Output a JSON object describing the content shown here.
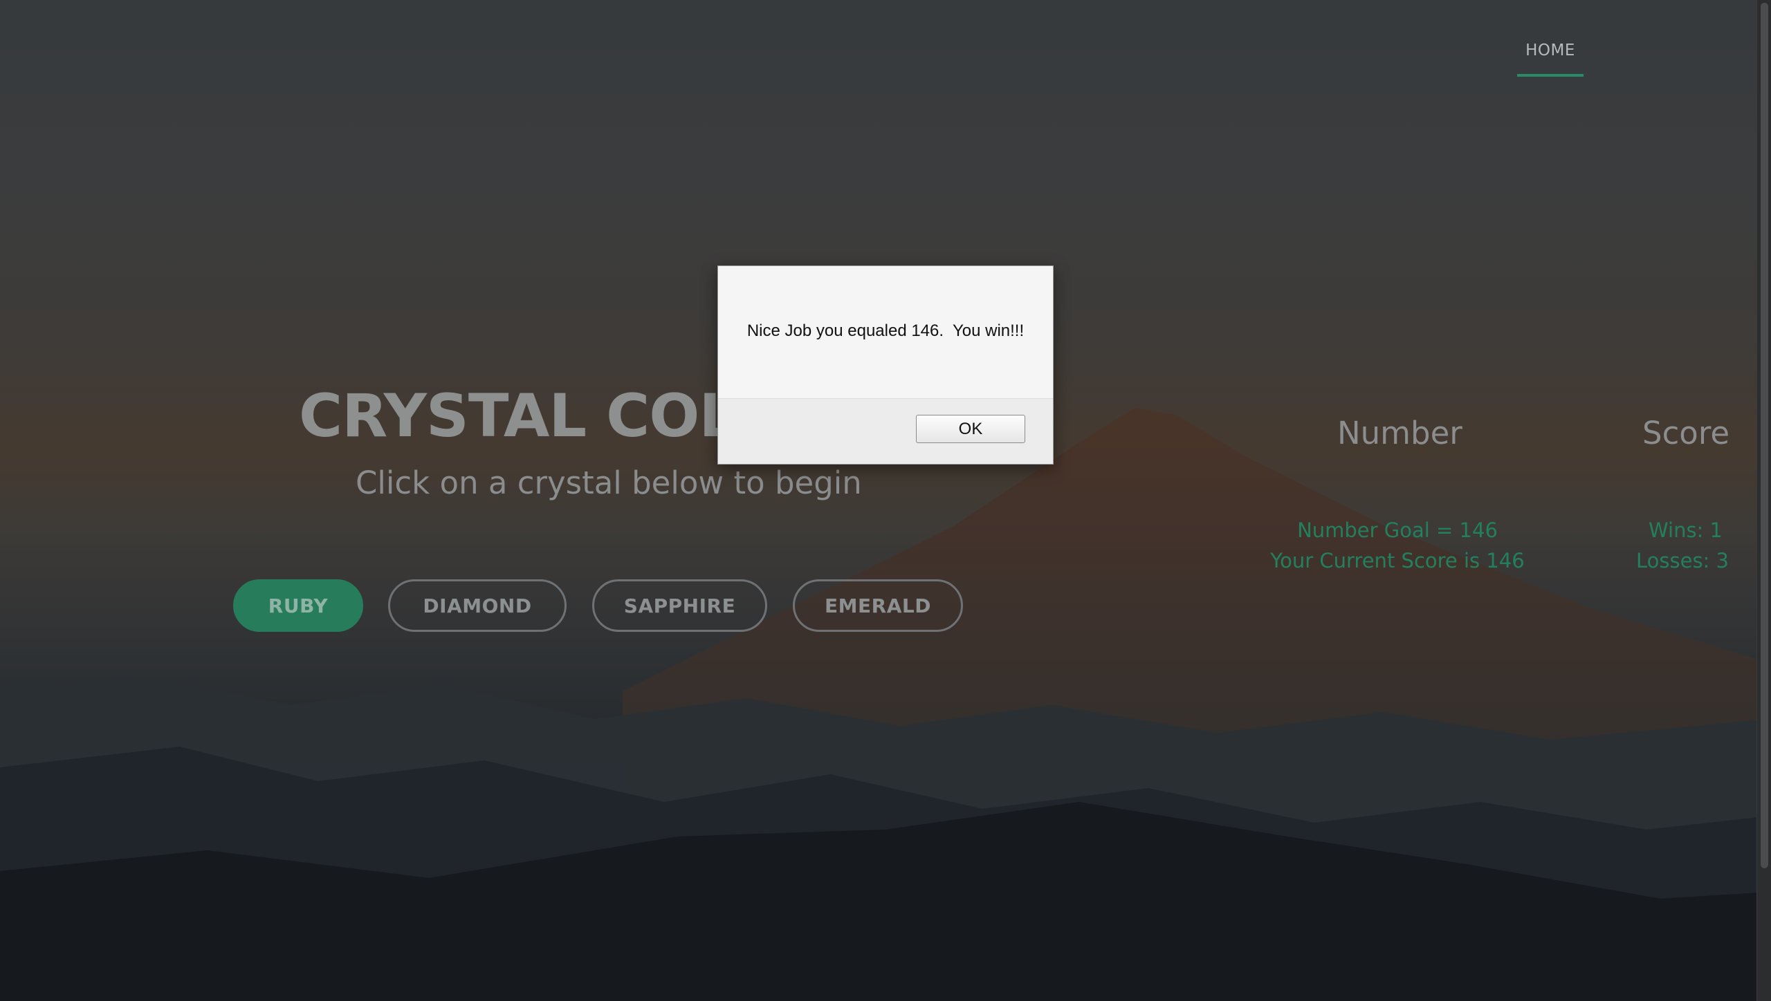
{
  "nav": {
    "home_label": "HOME"
  },
  "hero": {
    "title": "CRYSTAL COLLISION",
    "subtitle": "Click on a crystal below to begin"
  },
  "crystals": [
    {
      "label": "RUBY",
      "selected": true
    },
    {
      "label": "DIAMOND",
      "selected": false
    },
    {
      "label": "SAPPHIRE",
      "selected": false
    },
    {
      "label": "EMERALD",
      "selected": false
    }
  ],
  "scoreboard": {
    "number_heading": "Number",
    "score_heading": "Score",
    "number_goal": "Number Goal = 146",
    "current_score": "Your Current Score is 146",
    "wins": "Wins: 1",
    "losses": "Losses: 3"
  },
  "alert": {
    "message": "Nice Job you equaled 146.  You win!!!",
    "ok_label": "OK"
  },
  "colors": {
    "accent_green": "#267c5b",
    "stat_green": "#23805e"
  }
}
